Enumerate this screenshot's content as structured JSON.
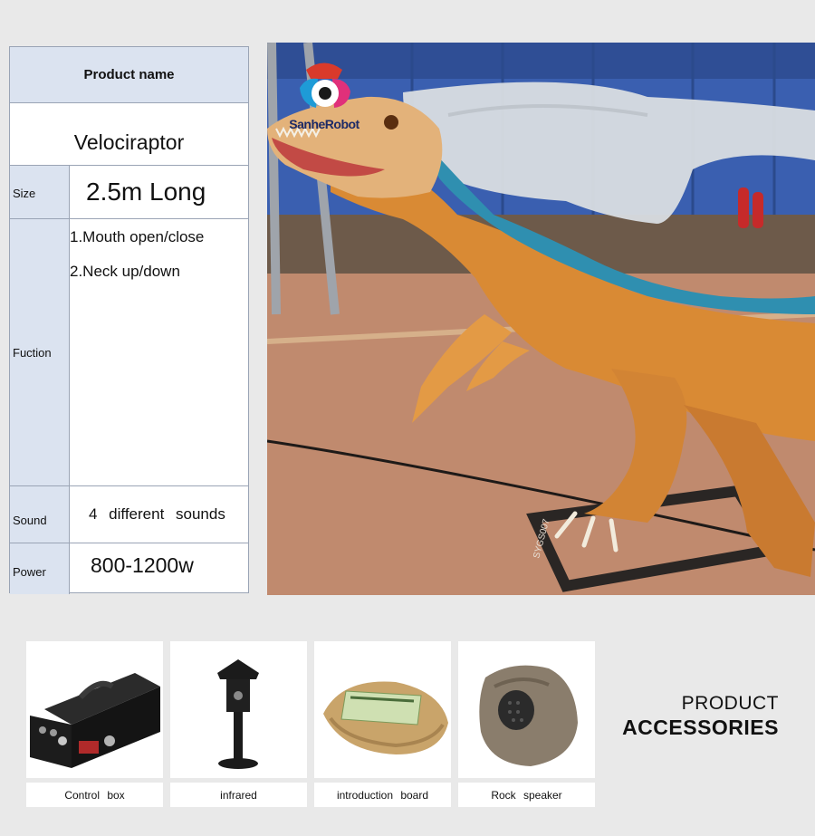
{
  "spec": {
    "header": "Product  name",
    "name": "Velociraptor",
    "size_label": "Size",
    "size_value": "2.5m   Long",
    "function_label": "Fuction",
    "functions": [
      "1.Mouth   open/close",
      "2.Neck   up/down"
    ],
    "sound_label": "Sound",
    "sound_value": "4  different  sounds",
    "power_label": "Power",
    "power_value": "800-1200w"
  },
  "logo": {
    "text": "SanheRobot",
    "icon": "robot-eye-logo"
  },
  "accessories": {
    "heading_line1": "PRODUCT",
    "heading_line2": "ACCESSORIES",
    "items": [
      {
        "label": "Control  box",
        "icon": "control-box"
      },
      {
        "label": "infrared",
        "icon": "infrared-sensor"
      },
      {
        "label": "introduction  board",
        "icon": "introduction-board"
      },
      {
        "label": "Rock  speaker",
        "icon": "rock-speaker"
      }
    ]
  },
  "photo": {
    "base_text": "SYGS007"
  },
  "colors": {
    "table_label_bg": "#dbe3f0",
    "page_bg": "#e9e9e9",
    "heading": "#111111"
  }
}
